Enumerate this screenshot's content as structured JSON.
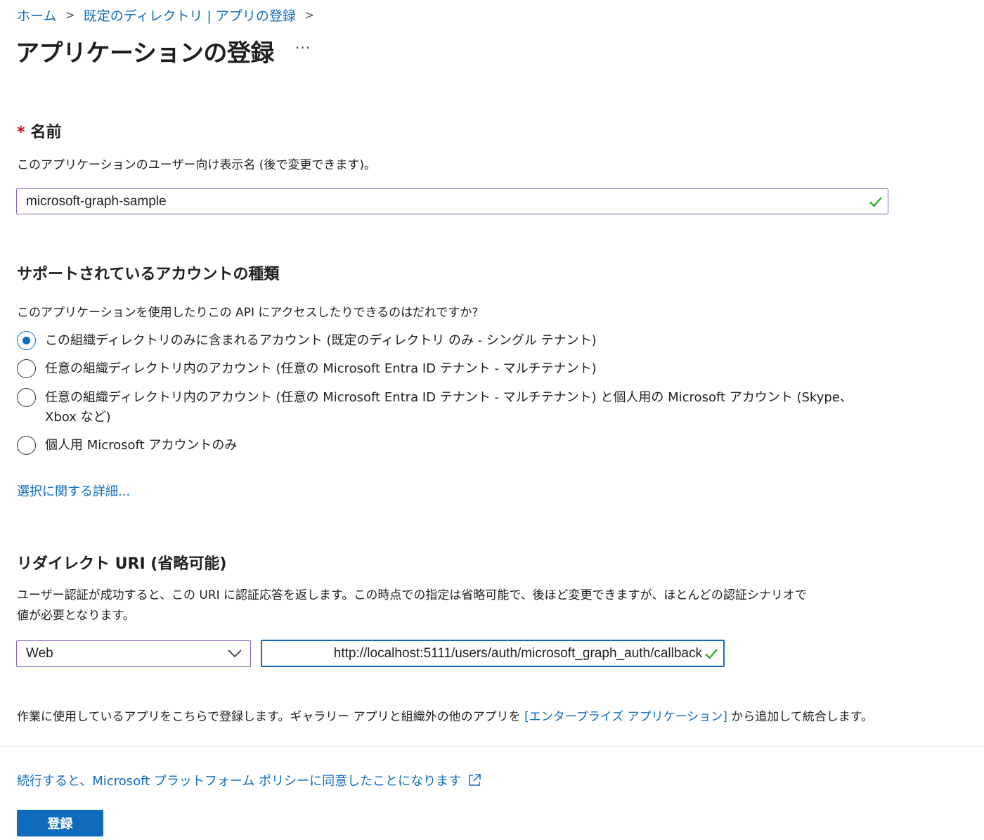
{
  "breadcrumb": {
    "home": "ホーム",
    "directory": "既定のディレクトリ | アプリの登録"
  },
  "page": {
    "title": "アプリケーションの登録",
    "more": "···"
  },
  "name_section": {
    "required_mark": "*",
    "heading": "名前",
    "description": "このアプリケーションのユーザー向け表示名 (後で変更できます)。",
    "value": "microsoft-graph-sample"
  },
  "account_section": {
    "heading": "サポートされているアカウントの種類",
    "question": "このアプリケーションを使用したりこの API にアクセスしたりできるのはだれですか?",
    "options": [
      {
        "label": "この組織ディレクトリのみに含まれるアカウント (既定のディレクトリ のみ - シングル テナント)",
        "selected": true
      },
      {
        "label": "任意の組織ディレクトリ内のアカウント (任意の Microsoft Entra ID テナント - マルチテナント)",
        "selected": false
      },
      {
        "label_line1": "任意の組織ディレクトリ内のアカウント (任意の Microsoft Entra ID テナント - マルチテナント) と個人用の Microsoft アカウント (Skype、",
        "label_line2": "Xbox など)",
        "selected": false
      },
      {
        "label": "個人用 Microsoft アカウントのみ",
        "selected": false
      }
    ],
    "help_link": "選択に関する詳細..."
  },
  "redirect_section": {
    "heading": "リダイレクト URI (省略可能)",
    "description_line1": "ユーザー認証が成功すると、この URI に認証応答を返します。この時点での指定は省略可能で、後ほど変更できますが、ほとんどの認証シナリオで",
    "description_line2": "値が必要となります。",
    "platform": "Web",
    "uri": "http://localhost:5111/users/auth/microsoft_graph_auth/callback"
  },
  "footer_note": {
    "before": "作業に使用しているアプリをこちらで登録します。ギャラリー アプリと組織外の他のアプリを ",
    "link": "[エンタープライズ アプリケーション]",
    "after": " から追加して統合します。"
  },
  "policy": {
    "link": "続行すると、Microsoft プラットフォーム ポリシーに同意したことになります"
  },
  "actions": {
    "register": "登録"
  },
  "colors": {
    "link": "#0f6cbd",
    "required": "#c50f1f",
    "focus_border": "#8764b8",
    "valid_check": "#13a10e",
    "primary_button": "#0f6cbd"
  },
  "icons": {
    "breadcrumb_separator": "chevron-right-icon",
    "valid": "checkmark-icon",
    "dropdown": "chevron-down-icon",
    "external": "open-in-new-icon"
  }
}
